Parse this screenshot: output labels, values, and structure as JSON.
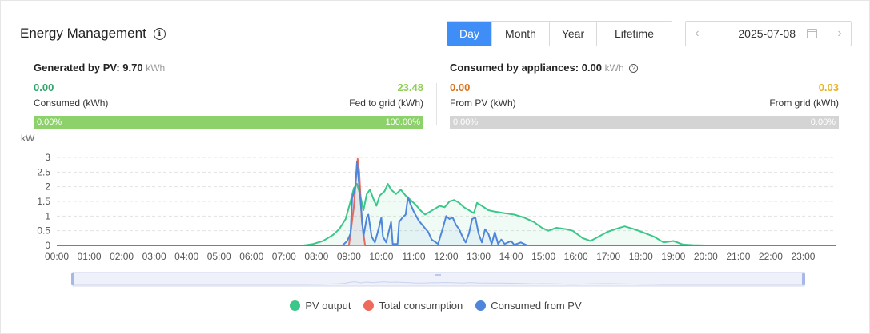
{
  "header": {
    "title": "Energy Management",
    "tabs": [
      {
        "label": "Day",
        "active": true
      },
      {
        "label": "Month",
        "active": false
      },
      {
        "label": "Year",
        "active": false
      },
      {
        "label": "Lifetime",
        "active": false
      }
    ],
    "date": "2025-07-08"
  },
  "generated": {
    "label": "Generated by PV:",
    "value": "9.70",
    "unit": "kWh",
    "left_value": "0.00",
    "left_label": "Consumed (kWh)",
    "right_value": "23.48",
    "right_label": "Fed to grid (kWh)",
    "bar_left": "0.00%",
    "bar_right": "100.00%",
    "bar_fill_fraction": 1.0,
    "left_color": "#2ea56b",
    "right_color": "#8fcf55",
    "bar_color": "#8cd16a"
  },
  "consumed": {
    "label": "Consumed by appliances:",
    "value": "0.00",
    "unit": "kWh",
    "left_value": "0.00",
    "left_label": "From PV (kWh)",
    "right_value": "0.03",
    "right_label": "From grid (kWh)",
    "bar_left": "0.00%",
    "bar_right": "0.00%",
    "bar_fill_fraction": 0.0,
    "left_color": "#d9731f",
    "right_color": "#e6b422"
  },
  "chart_data": {
    "type": "line",
    "ylabel": "kW",
    "ylim": [
      0,
      3
    ],
    "yticks": [
      "0",
      "0.5",
      "1",
      "1.5",
      "2",
      "2.5",
      "3"
    ],
    "xticks": [
      "00:00",
      "01:00",
      "02:00",
      "03:00",
      "04:00",
      "05:00",
      "06:00",
      "07:00",
      "08:00",
      "09:00",
      "10:00",
      "11:00",
      "12:00",
      "13:00",
      "14:00",
      "15:00",
      "16:00",
      "17:00",
      "18:00",
      "19:00",
      "20:00",
      "21:00",
      "22:00",
      "23:00"
    ],
    "grid": true,
    "legend_position": "bottom",
    "series": [
      {
        "name": "PV output",
        "color": "#3cc78a",
        "points": [
          [
            0,
            0
          ],
          [
            7.6,
            0
          ],
          [
            7.9,
            0.05
          ],
          [
            8.2,
            0.15
          ],
          [
            8.5,
            0.35
          ],
          [
            8.7,
            0.55
          ],
          [
            8.9,
            0.9
          ],
          [
            9.05,
            1.5
          ],
          [
            9.15,
            1.95
          ],
          [
            9.25,
            2.1
          ],
          [
            9.35,
            1.7
          ],
          [
            9.45,
            1.2
          ],
          [
            9.55,
            1.75
          ],
          [
            9.65,
            1.9
          ],
          [
            9.75,
            1.6
          ],
          [
            9.85,
            1.35
          ],
          [
            9.95,
            1.7
          ],
          [
            10.1,
            1.85
          ],
          [
            10.2,
            2.1
          ],
          [
            10.3,
            1.9
          ],
          [
            10.45,
            1.75
          ],
          [
            10.6,
            1.9
          ],
          [
            10.75,
            1.7
          ],
          [
            10.9,
            1.55
          ],
          [
            11.05,
            1.4
          ],
          [
            11.2,
            1.2
          ],
          [
            11.35,
            1.05
          ],
          [
            11.5,
            1.15
          ],
          [
            11.65,
            1.25
          ],
          [
            11.8,
            1.35
          ],
          [
            11.95,
            1.3
          ],
          [
            12.1,
            1.5
          ],
          [
            12.25,
            1.55
          ],
          [
            12.4,
            1.45
          ],
          [
            12.55,
            1.3
          ],
          [
            12.7,
            1.2
          ],
          [
            12.85,
            1.1
          ],
          [
            12.95,
            1.45
          ],
          [
            13.1,
            1.35
          ],
          [
            13.3,
            1.2
          ],
          [
            13.5,
            1.15
          ],
          [
            13.8,
            1.1
          ],
          [
            14.1,
            1.05
          ],
          [
            14.4,
            0.95
          ],
          [
            14.7,
            0.8
          ],
          [
            14.95,
            0.6
          ],
          [
            15.15,
            0.5
          ],
          [
            15.4,
            0.6
          ],
          [
            15.7,
            0.55
          ],
          [
            15.9,
            0.5
          ],
          [
            16.2,
            0.25
          ],
          [
            16.45,
            0.15
          ],
          [
            16.7,
            0.3
          ],
          [
            16.95,
            0.45
          ],
          [
            17.2,
            0.55
          ],
          [
            17.5,
            0.65
          ],
          [
            17.8,
            0.55
          ],
          [
            18.05,
            0.45
          ],
          [
            18.4,
            0.3
          ],
          [
            18.7,
            0.1
          ],
          [
            19.0,
            0.15
          ],
          [
            19.3,
            0.03
          ],
          [
            19.6,
            0.01
          ],
          [
            20,
            0
          ],
          [
            24,
            0
          ]
        ]
      },
      {
        "name": "Total consumption",
        "color": "#ee6a5a",
        "points": [
          [
            0,
            0
          ],
          [
            9.0,
            0
          ],
          [
            9.05,
            0.4
          ],
          [
            9.15,
            1.3
          ],
          [
            9.22,
            2.3
          ],
          [
            9.27,
            2.95
          ],
          [
            9.32,
            2.5
          ],
          [
            9.4,
            0.8
          ],
          [
            9.5,
            0
          ],
          [
            24,
            0
          ]
        ]
      },
      {
        "name": "Consumed from PV",
        "color": "#4f86dc",
        "points": [
          [
            0,
            0
          ],
          [
            8.8,
            0
          ],
          [
            8.95,
            0.15
          ],
          [
            9.05,
            0.4
          ],
          [
            9.1,
            1.6
          ],
          [
            9.2,
            2.0
          ],
          [
            9.25,
            2.85
          ],
          [
            9.35,
            1.6
          ],
          [
            9.45,
            0.3
          ],
          [
            9.55,
            0.95
          ],
          [
            9.6,
            1.05
          ],
          [
            9.7,
            0.3
          ],
          [
            9.8,
            0.1
          ],
          [
            9.9,
            0.5
          ],
          [
            10.0,
            0.95
          ],
          [
            10.05,
            0.3
          ],
          [
            10.15,
            0.1
          ],
          [
            10.3,
            0.8
          ],
          [
            10.35,
            0.05
          ],
          [
            10.5,
            0.05
          ],
          [
            10.55,
            0.8
          ],
          [
            10.65,
            0.95
          ],
          [
            10.75,
            1.05
          ],
          [
            10.82,
            1.65
          ],
          [
            10.9,
            1.4
          ],
          [
            11.0,
            1.15
          ],
          [
            11.15,
            0.85
          ],
          [
            11.3,
            0.65
          ],
          [
            11.45,
            0.45
          ],
          [
            11.55,
            0.2
          ],
          [
            11.75,
            0.05
          ],
          [
            11.9,
            0.6
          ],
          [
            12.0,
            1.0
          ],
          [
            12.1,
            0.9
          ],
          [
            12.2,
            0.95
          ],
          [
            12.3,
            0.7
          ],
          [
            12.4,
            0.55
          ],
          [
            12.5,
            0.3
          ],
          [
            12.6,
            0.1
          ],
          [
            12.7,
            0.4
          ],
          [
            12.8,
            0.9
          ],
          [
            12.9,
            0.95
          ],
          [
            13.0,
            0.4
          ],
          [
            13.1,
            0.1
          ],
          [
            13.2,
            0.55
          ],
          [
            13.3,
            0.4
          ],
          [
            13.4,
            0.05
          ],
          [
            13.5,
            0.45
          ],
          [
            13.6,
            0.05
          ],
          [
            13.7,
            0.2
          ],
          [
            13.8,
            0.05
          ],
          [
            14.0,
            0.15
          ],
          [
            14.1,
            0.02
          ],
          [
            14.3,
            0.1
          ],
          [
            14.5,
            0
          ],
          [
            24,
            0
          ]
        ]
      }
    ]
  },
  "legend": [
    {
      "label": "PV output",
      "color": "#3cc78a"
    },
    {
      "label": "Total consumption",
      "color": "#ee6a5a"
    },
    {
      "label": "Consumed from PV",
      "color": "#4f86dc"
    }
  ]
}
